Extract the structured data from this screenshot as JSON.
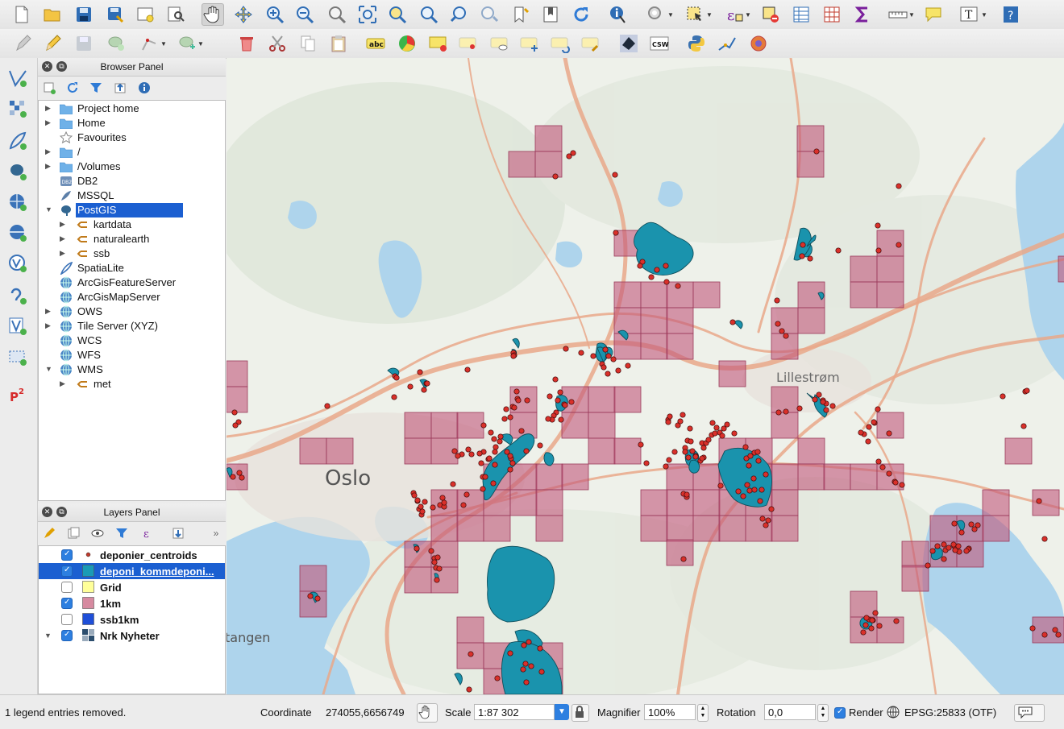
{
  "browser_panel": {
    "title": "Browser Panel",
    "items": [
      {
        "label": "Project home",
        "icon": "folder-icon",
        "expandable": true
      },
      {
        "label": "Home",
        "icon": "folder-icon",
        "expandable": true
      },
      {
        "label": "Favourites",
        "icon": "star-icon",
        "expandable": false
      },
      {
        "label": "/",
        "icon": "folder-icon",
        "expandable": true
      },
      {
        "label": "/Volumes",
        "icon": "folder-icon",
        "expandable": true
      },
      {
        "label": "DB2",
        "icon": "db2-icon",
        "expandable": false
      },
      {
        "label": "MSSQL",
        "icon": "mssql-icon",
        "expandable": false
      },
      {
        "label": "PostGIS",
        "icon": "elephant-icon",
        "expandable": true,
        "expanded": true,
        "selected": true
      },
      {
        "label": "kartdata",
        "icon": "schema-icon",
        "child": true
      },
      {
        "label": "naturalearth",
        "icon": "schema-icon",
        "child": true
      },
      {
        "label": "ssb",
        "icon": "schema-icon",
        "child": true
      },
      {
        "label": "SpatiaLite",
        "icon": "feather-icon",
        "expandable": false
      },
      {
        "label": "ArcGisFeatureServer",
        "icon": "globe-icon",
        "expandable": false
      },
      {
        "label": "ArcGisMapServer",
        "icon": "globe-icon",
        "expandable": false
      },
      {
        "label": "OWS",
        "icon": "globe-icon",
        "expandable": true
      },
      {
        "label": "Tile Server (XYZ)",
        "icon": "globe-icon",
        "expandable": true
      },
      {
        "label": "WCS",
        "icon": "globe-icon",
        "expandable": false
      },
      {
        "label": "WFS",
        "icon": "globe-icon",
        "expandable": false
      },
      {
        "label": "WMS",
        "icon": "globe-icon",
        "expandable": true,
        "expanded": true
      },
      {
        "label": "met",
        "icon": "schema-icon",
        "child": true
      }
    ]
  },
  "layers_panel": {
    "title": "Layers Panel",
    "layers": [
      {
        "label": "deponier_centroids",
        "checked": true,
        "symbol": "point",
        "color": "#c0392b"
      },
      {
        "label": "deponi_kommdeponi...",
        "checked": true,
        "symbol": "fill",
        "color": "#1a9bb5",
        "selected": true
      },
      {
        "label": "Grid",
        "checked": false,
        "symbol": "fill",
        "color": "#ffff99"
      },
      {
        "label": "1km",
        "checked": true,
        "symbol": "fill",
        "color": "#d68aa0"
      },
      {
        "label": "ssb1km",
        "checked": false,
        "symbol": "fill",
        "color": "#1f4fd8"
      },
      {
        "label": "Nrk Nyheter",
        "checked": true,
        "symbol": "raster",
        "color": "#2c4e6e"
      }
    ]
  },
  "map": {
    "labels": {
      "oslo": "Oslo",
      "lillestrom": "Lillestrøm",
      "tangen": "tangen"
    },
    "colors": {
      "grid_fill": "#c2567a",
      "polygon_fill": "#1a93ad",
      "point_fill": "#d9302a",
      "water": "#aed4ec",
      "land": "#eef1ea",
      "road": "#e9a88a"
    }
  },
  "toolbar": {
    "csw_label": "CSW",
    "abc_label": "abc"
  },
  "statusbar": {
    "message": "1 legend entries removed.",
    "coordinate_label": "Coordinate",
    "coordinate_value": "274055,6656749",
    "scale_label": "Scale",
    "scale_value": "1:87 302",
    "magnifier_label": "Magnifier",
    "magnifier_value": "100%",
    "rotation_label": "Rotation",
    "rotation_value": "0,0",
    "render_label": "Render",
    "crs_label": "EPSG:25833 (OTF)"
  }
}
